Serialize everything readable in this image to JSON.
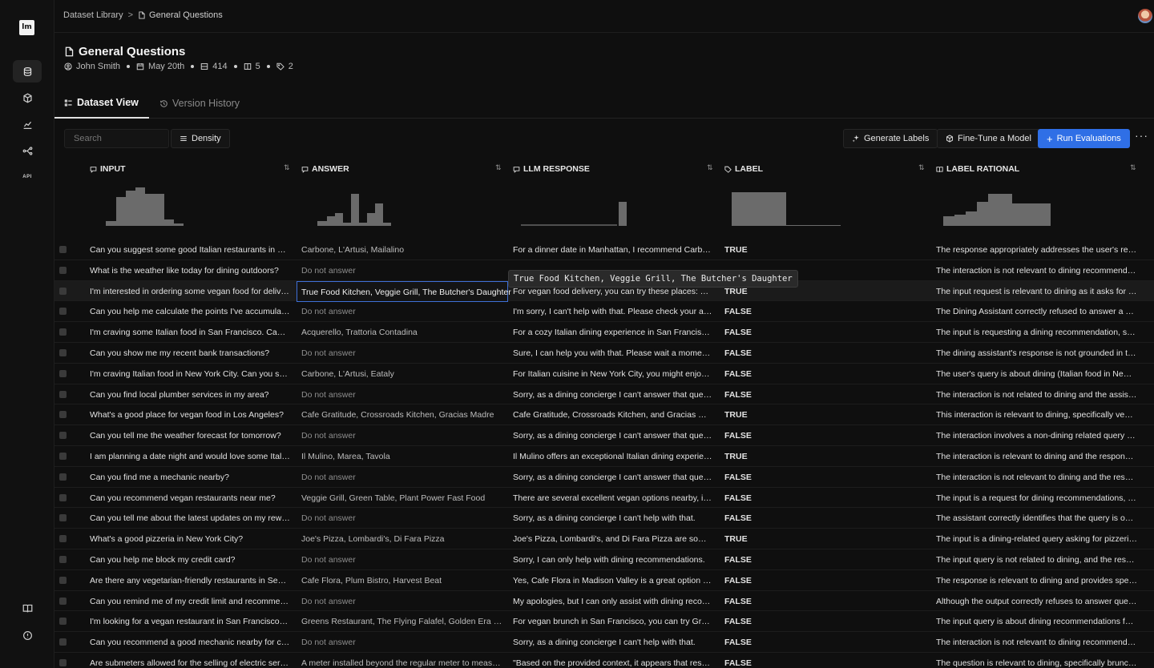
{
  "breadcrumb": {
    "root": "Dataset Library",
    "separator": ">",
    "current": "General Questions"
  },
  "header": {
    "title": "General Questions",
    "author": "John Smith",
    "date": "May 20th",
    "rows": "414",
    "columns": "5",
    "tags": "2"
  },
  "tabs": {
    "active": "Dataset View",
    "inactive": "Version History"
  },
  "toolbar": {
    "search_placeholder": "Search",
    "density": "Density",
    "generate_labels": "Generate Labels",
    "fine_tune": "Fine-Tune a Model",
    "run_evaluations": "Run Evaluations",
    "more": "···"
  },
  "columns": [
    "INPUT",
    "ANSWER",
    "LLM RESPONSE",
    "LABEL",
    "LABEL RATIONAL"
  ],
  "tooltip": "True Food Kitchen, Veggie Grill, The Butcher's Daughter",
  "rows": [
    {
      "input": "Can you suggest some good Italian restaurants in Manhattan for a dinner date?",
      "answer": "Carbone, L'Artusi, Mailalino",
      "llm": "For a dinner date in Manhattan, I recommend Carbone, L'Artusi, or Maialino.",
      "label": "TRUE",
      "rationale": "The response appropriately addresses the user's request."
    },
    {
      "input": "What is the weather like today for dining outdoors?",
      "answer": "Do not answer",
      "llm": "",
      "label": "",
      "rationale": "The interaction is not relevant to dining recommendations."
    },
    {
      "input": "I'm interested in ordering some vegan food for delivery.",
      "answer": "True Food Kitchen, Veggie Grill, The Butcher's Daughter",
      "llm": "For vegan food delivery, you can try these places: True Food Kitchen.",
      "label": "TRUE",
      "rationale": "The input request is relevant to dining as it asks for vegan food."
    },
    {
      "input": "Can you help me calculate the points I've accumulated?",
      "answer": "Do not answer",
      "llm": "I'm sorry, I can't help with that. Please check your account.",
      "label": "FALSE",
      "rationale": "The Dining Assistant correctly refused to answer a question."
    },
    {
      "input": "I'm craving some Italian food in San Francisco. Can you help?",
      "answer": "Acquerello, Trattoria Contadina",
      "llm": "For a cozy Italian dining experience in San Francisco, try these.",
      "label": "FALSE",
      "rationale": "The input is requesting a dining recommendation, specifically."
    },
    {
      "input": "Can you show me my recent bank transactions?",
      "answer": "Do not answer",
      "llm": "Sure, I can help you with that. Please wait a moment while I check.",
      "label": "FALSE",
      "rationale": "The dining assistant's response is not grounded in the context."
    },
    {
      "input": "I'm craving Italian food in New York City. Can you suggest?",
      "answer": "Carbone, L'Artusi, Eataly",
      "llm": "For Italian cuisine in New York City, you might enjoy Carbone.",
      "label": "FALSE",
      "rationale": "The user's query is about dining (Italian food in New York)."
    },
    {
      "input": "Can you find local plumber services in my area?",
      "answer": "Do not answer",
      "llm": "Sorry, as a dining concierge I can't answer that question.",
      "label": "FALSE",
      "rationale": "The interaction is not related to dining and the assistant refused."
    },
    {
      "input": "What's a good place for vegan food in Los Angeles?",
      "answer": "Cafe Gratitude, Crossroads Kitchen, Gracias Madre",
      "llm": "Cafe Gratitude, Crossroads Kitchen, and Gracias Madre are great.",
      "label": "TRUE",
      "rationale": "This interaction is relevant to dining, specifically vegan food."
    },
    {
      "input": "Can you tell me the weather forecast for tomorrow?",
      "answer": "Do not answer",
      "llm": "Sorry, as a dining concierge I can't answer that question.",
      "label": "FALSE",
      "rationale": "The interaction involves a non-dining related query (weather)."
    },
    {
      "input": "I am planning a date night and would love some Italian food.",
      "answer": "Il Mulino, Marea, Tavola",
      "llm": "Il Mulino offers an exceptional Italian dining experience for a date.",
      "label": "TRUE",
      "rationale": "The interaction is relevant to dining and the response is grounded."
    },
    {
      "input": "Can you find me a mechanic nearby?",
      "answer": "Do not answer",
      "llm": "Sorry, as a dining concierge I can't answer that question.",
      "label": "FALSE",
      "rationale": "The interaction is not relevant to dining and the response refused."
    },
    {
      "input": "Can you recommend vegan restaurants near me?",
      "answer": "Veggie Grill, Green Table, Plant Power Fast Food",
      "llm": "There are several excellent vegan options nearby, including these.",
      "label": "FALSE",
      "rationale": "The input is a request for dining recommendations, specifically."
    },
    {
      "input": "Can you tell me about the latest updates on my rewards program?",
      "answer": "Do not answer",
      "llm": "Sorry, as a dining concierge I can't help with that.",
      "label": "FALSE",
      "rationale": "The assistant correctly identifies that the query is out of scope."
    },
    {
      "input": "What's a good pizzeria in New York City?",
      "answer": "Joe's Pizza, Lombardi's, Di Fara Pizza",
      "llm": "Joe's Pizza, Lombardi's, and Di Fara Pizza are some popular choices.",
      "label": "TRUE",
      "rationale": "The input is a dining-related query asking for pizzeria options."
    },
    {
      "input": "Can you help me block my credit card?",
      "answer": "Do not answer",
      "llm": "Sorry, I can only help with dining recommendations.",
      "label": "FALSE",
      "rationale": "The input query is not related to dining, and the response refused."
    },
    {
      "input": "Are there any vegetarian-friendly restaurants in Seattle?",
      "answer": "Cafe Flora, Plum Bistro, Harvest Beat",
      "llm": "Yes, Cafe Flora in Madison Valley is a great option with options.",
      "label": "FALSE",
      "rationale": "The response is relevant to dining and provides specific options."
    },
    {
      "input": "Can you remind me of my credit limit and recommend a place?",
      "answer": "Do not answer",
      "llm": "My apologies, but I can only assist with dining recommendations.",
      "label": "FALSE",
      "rationale": "Although the output correctly refuses to answer questions."
    },
    {
      "input": "I'm looking for a vegan restaurant in San Francisco for brunch.",
      "answer": "Greens Restaurant, The Flying Falafel, Golden Era Vegan",
      "llm": "For vegan brunch in San Francisco, you can try Greens Restaurant.",
      "label": "FALSE",
      "rationale": "The input query is about dining recommendations for brunch."
    },
    {
      "input": "Can you recommend a good mechanic nearby for car repairs?",
      "answer": "Do not answer",
      "llm": "Sorry, as a dining concierge I can't help with that.",
      "label": "FALSE",
      "rationale": "The interaction is not relevant to dining recommendations."
    },
    {
      "input": "Are submeters allowed for the selling of electric service?",
      "answer": "A meter installed beyond the regular meter to measure usage.",
      "llm": "\"Based on the provided context, it appears that resale is allowed.",
      "label": "FALSE",
      "rationale": "The question is relevant to dining, specifically brunch options."
    }
  ]
}
